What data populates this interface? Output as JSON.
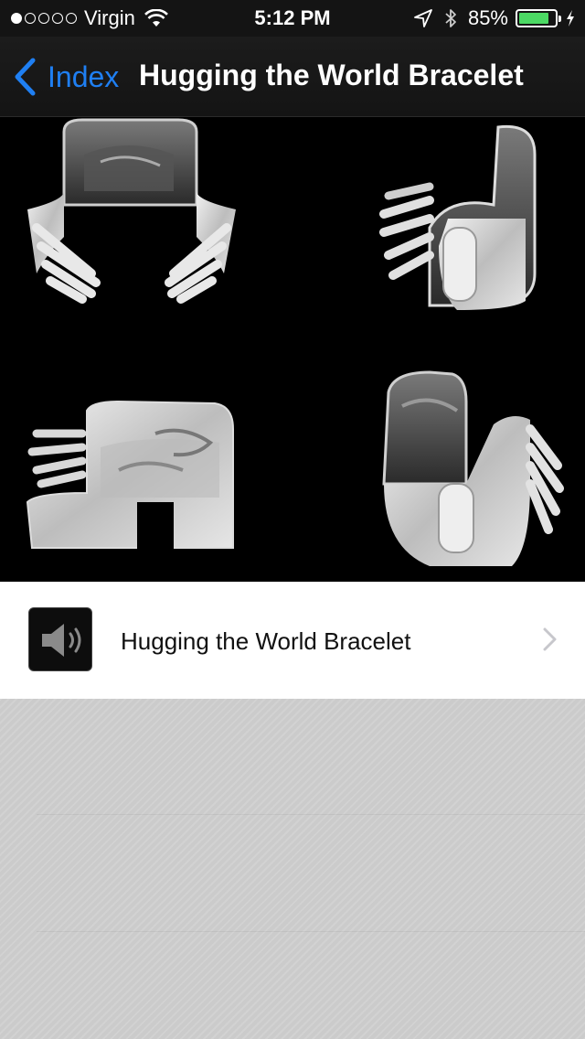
{
  "status_bar": {
    "signal_strength": "1 of 5",
    "carrier": "Virgin",
    "time": "5:12 PM",
    "battery_percent": "85%",
    "battery_level": 0.85,
    "icons": [
      "wifi-icon",
      "location-arrow-icon",
      "bluetooth-icon",
      "charging-bolt-icon"
    ],
    "battery_color": "#4cd964"
  },
  "nav": {
    "back_label": "Index",
    "title": "Hugging the World Bracelet",
    "accent_color": "#1f7ff2"
  },
  "photo": {
    "subject": "silver bracelet shown from four angles"
  },
  "audio_item": {
    "icon": "speaker-icon",
    "label": "Hugging the World Bracelet",
    "disclosure": "chevron-right-icon"
  }
}
